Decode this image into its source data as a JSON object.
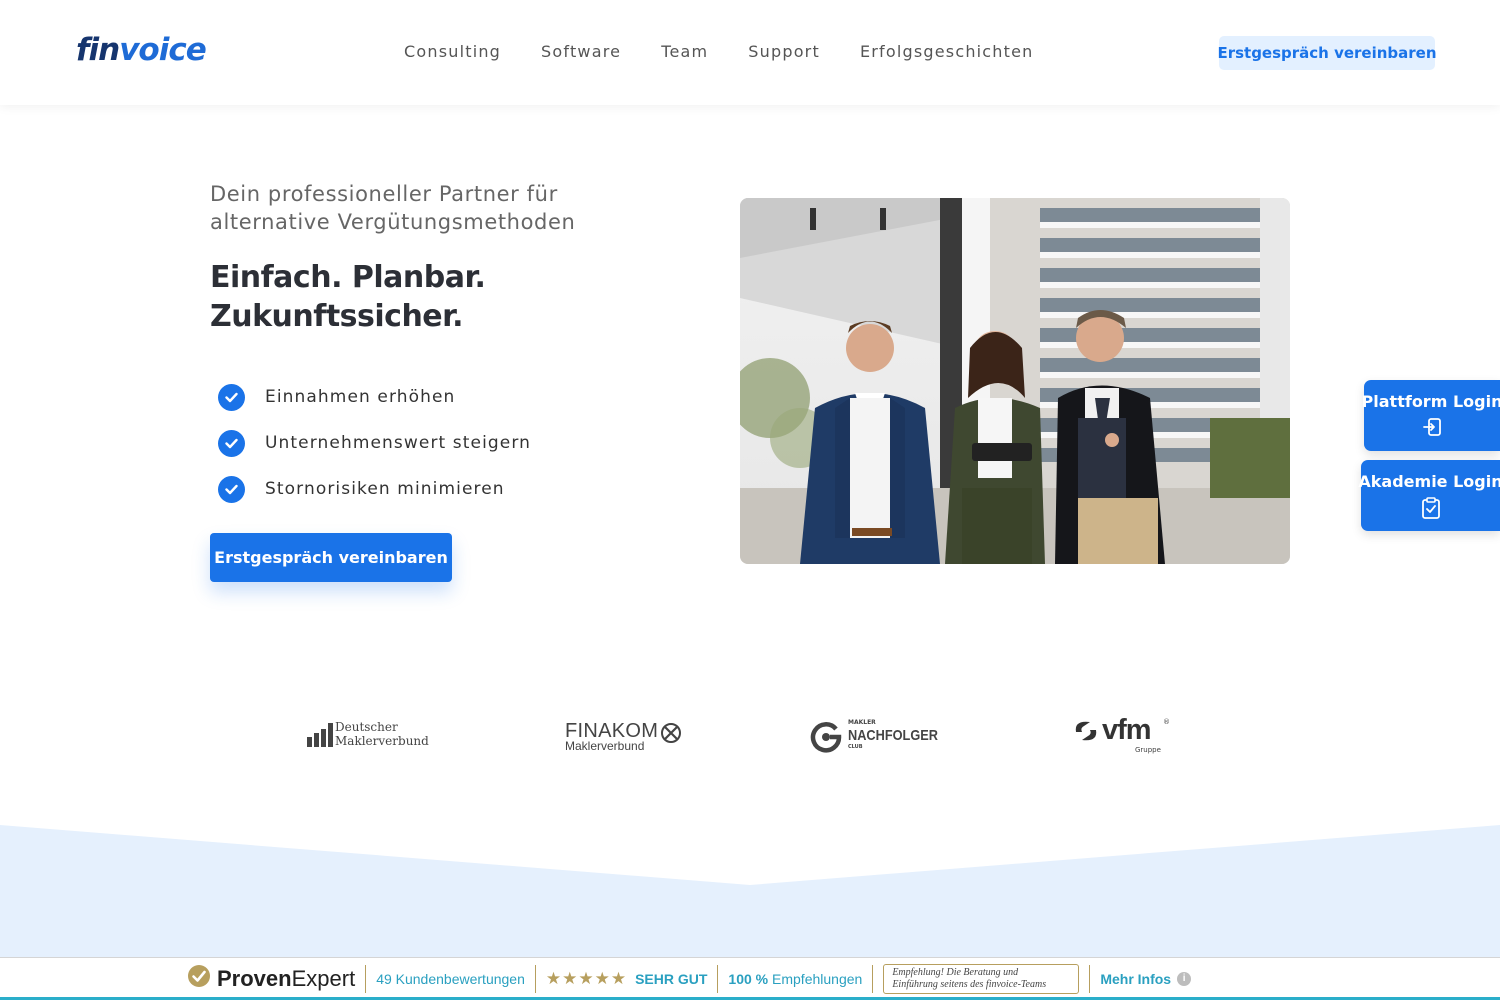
{
  "header": {
    "logo": {
      "part1": "fin",
      "part2": "voice"
    },
    "nav": [
      "Consulting",
      "Software",
      "Team",
      "Support",
      "Erfolgsgeschichten"
    ],
    "cta_label": "Erstgespräch vereinbaren"
  },
  "hero": {
    "subtitle": "Dein professioneller Partner für alternative Vergütungsmethoden",
    "headline_line1": "Einfach. Planbar.",
    "headline_line2": "Zukunftssicher.",
    "benefits": [
      "Einnahmen erhöhen",
      "Unternehmenswert steigern",
      "Stornorisiken minimieren"
    ],
    "cta_label": "Erstgespräch vereinbaren"
  },
  "side_logins": {
    "platform": "Plattform Login",
    "academy": "Akademie Login"
  },
  "partners": {
    "dmv": {
      "line1": "Deutscher",
      "line2": "Maklerverbund"
    },
    "finakom": {
      "name": "FINAKOM",
      "sub": "Maklerverbund"
    },
    "nachfolger": {
      "top": "MAKLER",
      "name": "NACHFOLGER",
      "bottom": "CLUB"
    },
    "vfm": {
      "name": "vfm",
      "mark": "®",
      "sub": "Gruppe"
    }
  },
  "proven_expert": {
    "brand_a": "Proven",
    "brand_b": "Expert",
    "reviews": "49 Kundenbewertungen",
    "stars": "★★★★★",
    "rating": "SEHR GUT",
    "recommendation_value": "100 %",
    "recommendation_label": "Empfehlungen",
    "quote_line1": "Empfehlung! Die Beratung und",
    "quote_line2": "Einführung seitens des finvoice-Teams",
    "more": "Mehr Infos",
    "info_glyph": "i"
  },
  "colors": {
    "primary": "#1a73e8",
    "primary_light": "#e3f0ff",
    "logo_dark": "#16356e",
    "pe_gold": "#b79f5e",
    "pe_teal": "#2aa0c0",
    "band": "#e5f0fd"
  },
  "icons": {
    "check": "check-circle-icon",
    "platform": "login-arrow-icon",
    "academy": "clipboard-check-icon",
    "pe_badge": "check-badge-icon",
    "info": "info-icon"
  }
}
